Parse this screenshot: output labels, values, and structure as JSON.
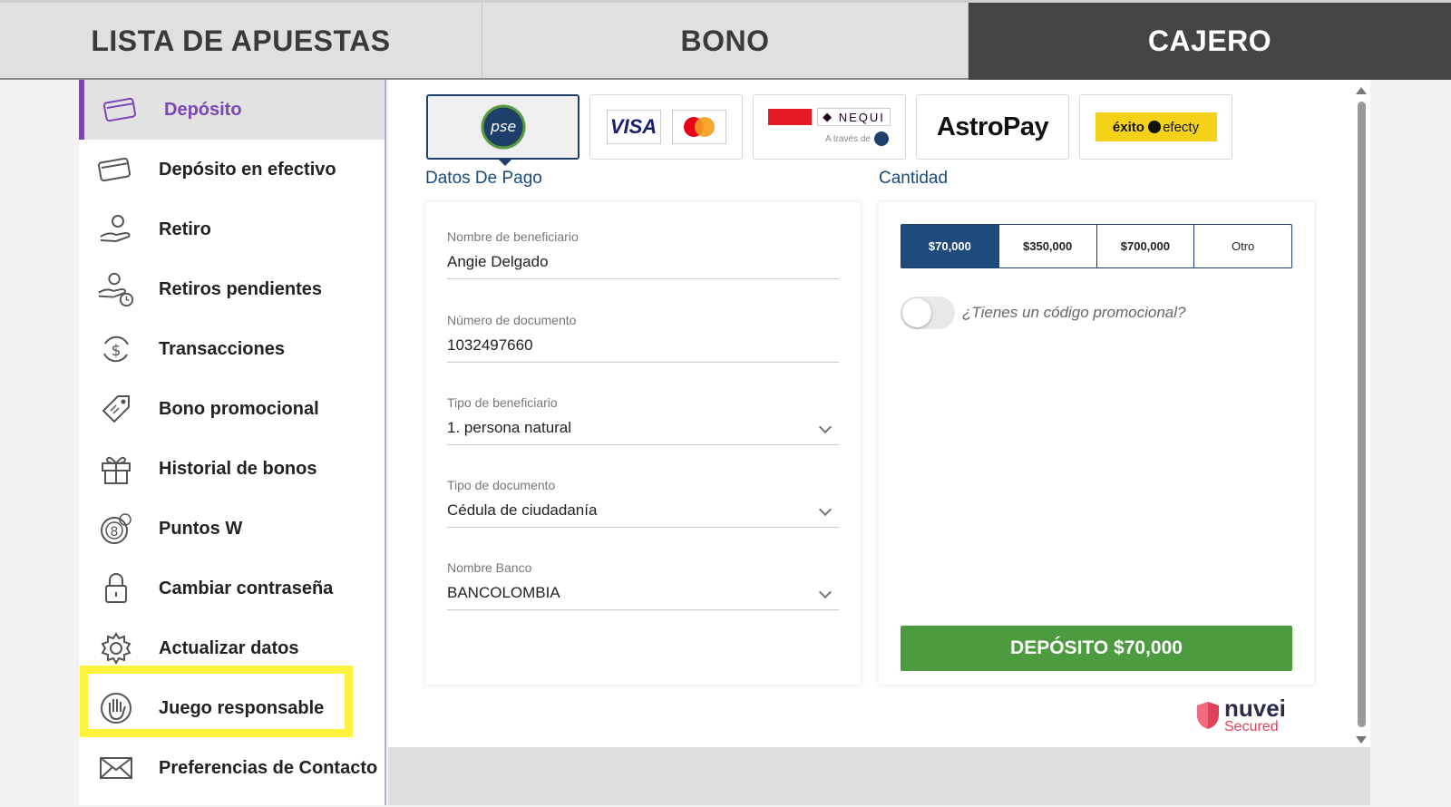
{
  "topnav": {
    "tabs": [
      {
        "label": "LISTA DE APUESTAS"
      },
      {
        "label": "BONO"
      },
      {
        "label": "CAJERO"
      }
    ]
  },
  "sidebar": {
    "items": [
      {
        "label": "Depósito",
        "icon": "card-icon"
      },
      {
        "label": "Depósito en efectivo",
        "icon": "cash-card-icon"
      },
      {
        "label": "Retiro",
        "icon": "hand-coin-icon"
      },
      {
        "label": "Retiros pendientes",
        "icon": "hand-coin-clock-icon"
      },
      {
        "label": "Transacciones",
        "icon": "dollar-cycle-icon"
      },
      {
        "label": "Bono promocional",
        "icon": "tag-icon"
      },
      {
        "label": "Historial de bonos",
        "icon": "gift-icon"
      },
      {
        "label": "Puntos W",
        "icon": "coin-8-icon"
      },
      {
        "label": "Cambiar contraseña",
        "icon": "lock-icon"
      },
      {
        "label": "Actualizar datos",
        "icon": "gear-icon"
      },
      {
        "label": "Juego responsable",
        "icon": "hand-icon"
      },
      {
        "label": "Preferencias de Contacto",
        "icon": "envelope-icon"
      }
    ]
  },
  "payment_methods": {
    "pse": "pse",
    "visa": "VISA",
    "nequi": "NEQUI",
    "nequi_via": "A través de",
    "astropay": "AstroPay",
    "exito": "éxito",
    "efecty": "efecty"
  },
  "payment_data": {
    "title": "Datos De Pago",
    "fields": [
      {
        "label": "Nombre de beneficiario",
        "value": "Angie Delgado"
      },
      {
        "label": "Número de documento",
        "value": "1032497660"
      },
      {
        "label": "Tipo de beneficiario",
        "value": "1. persona natural"
      },
      {
        "label": "Tipo de documento",
        "value": "Cédula de ciudadanía"
      },
      {
        "label": "Nombre Banco",
        "value": "BANCOLOMBIA"
      }
    ]
  },
  "amount": {
    "title": "Cantidad",
    "options": [
      "$70,000",
      "$350,000",
      "$700,000",
      "Otro"
    ],
    "promo_label": "¿Tienes un código promocional?",
    "deposit_button": "DEPÓSITO $70,000"
  },
  "footer": {
    "brand": "nuvei",
    "secured": "Secured"
  },
  "colors": {
    "accent_purple": "#7d45b5",
    "navy": "#1f4a7c",
    "green": "#4c9b3f",
    "highlight": "#fff23a"
  }
}
